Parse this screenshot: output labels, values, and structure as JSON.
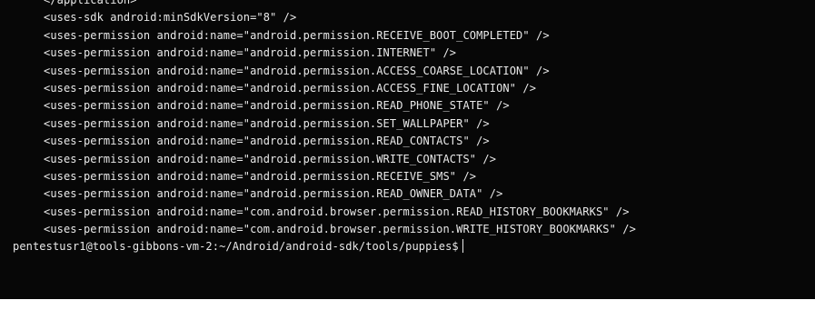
{
  "terminal": {
    "output_lines": [
      "</application>",
      "<uses-sdk android:minSdkVersion=\"8\" />",
      "<uses-permission android:name=\"android.permission.RECEIVE_BOOT_COMPLETED\" />",
      "<uses-permission android:name=\"android.permission.INTERNET\" />",
      "<uses-permission android:name=\"android.permission.ACCESS_COARSE_LOCATION\" />",
      "<uses-permission android:name=\"android.permission.ACCESS_FINE_LOCATION\" />",
      "<uses-permission android:name=\"android.permission.READ_PHONE_STATE\" />",
      "<uses-permission android:name=\"android.permission.SET_WALLPAPER\" />",
      "<uses-permission android:name=\"android.permission.READ_CONTACTS\" />",
      "<uses-permission android:name=\"android.permission.WRITE_CONTACTS\" />",
      "<uses-permission android:name=\"android.permission.RECEIVE_SMS\" />",
      "<uses-permission android:name=\"android.permission.READ_OWNER_DATA\" />",
      "<uses-permission android:name=\"com.android.browser.permission.READ_HISTORY_BOOKMARKS\" />",
      "<uses-permission android:name=\"com.android.browser.permission.WRITE_HISTORY_BOOKMARKS\" />"
    ],
    "prompt": "pentestusr1@tools-gibbons-vm-2:~/Android/android-sdk/tools/puppies$",
    "colors": {
      "background": "#070707",
      "text": "#e9e9e9"
    }
  }
}
